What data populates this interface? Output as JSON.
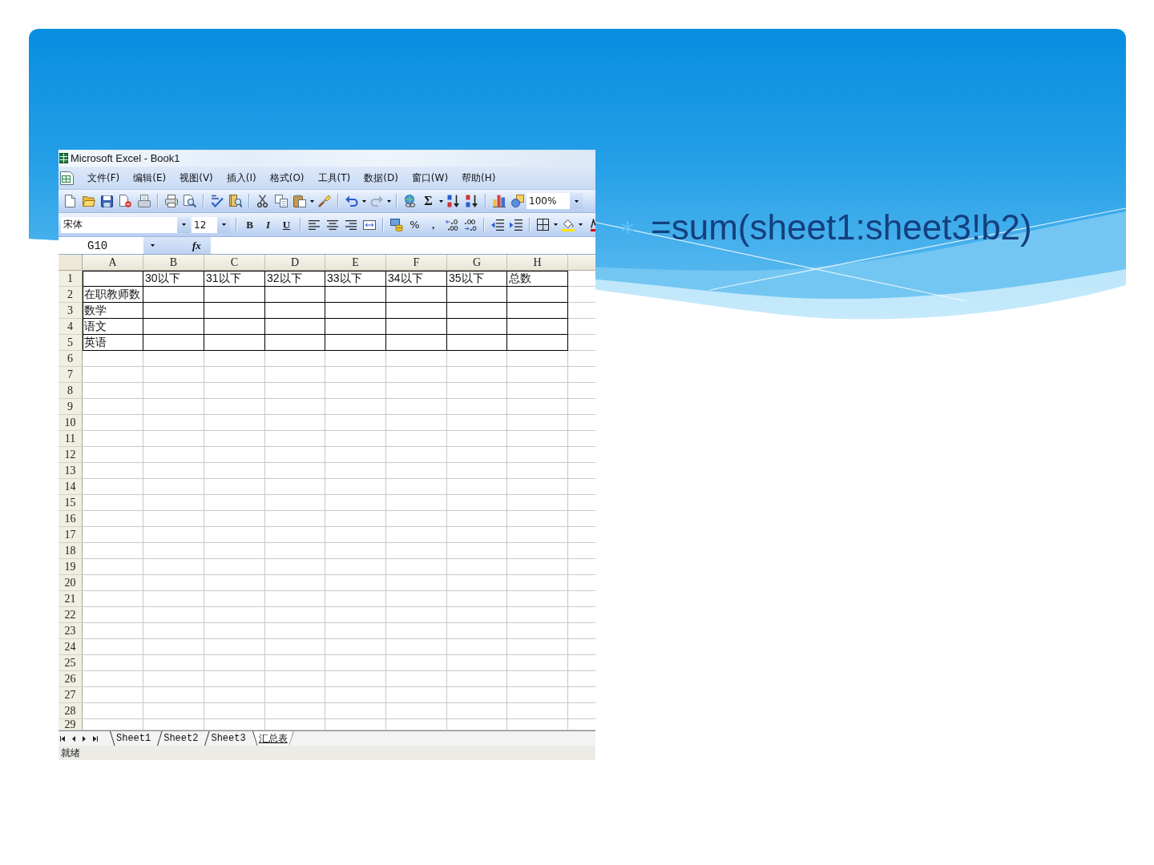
{
  "excel_window": {
    "title": "Microsoft Excel - Book1",
    "menu": [
      "文件(F)",
      "编辑(E)",
      "视图(V)",
      "插入(I)",
      "格式(O)",
      "工具(T)",
      "数据(D)",
      "窗口(W)",
      "帮助(H)"
    ],
    "standard_toolbar": {
      "redo": {
        "disabled": true
      },
      "autosum": "Σ",
      "zoom": "100%"
    },
    "formatting_toolbar": {
      "font": "宋体",
      "font_size": "12",
      "style_buttons": [
        "B",
        "I",
        "U"
      ],
      "percent": "%",
      "comma": ","
    },
    "formula_bar": {
      "name_box": "G10",
      "function_button": "fx"
    },
    "sheet": {
      "columns": [
        "A",
        "B",
        "C",
        "D",
        "E",
        "F",
        "G",
        "H"
      ],
      "rows": [
        {
          "number": "1",
          "bordered": true,
          "cells": [
            null,
            "30以下",
            "31以下",
            "32以下",
            "33以下",
            "34以下",
            "35以下",
            "总数"
          ]
        },
        {
          "number": "2",
          "bordered": true,
          "cells": [
            "在职教师数"
          ]
        },
        {
          "number": "3",
          "bordered": true,
          "cells": [
            "数学"
          ]
        },
        {
          "number": "4",
          "bordered": true,
          "cells": [
            "语文"
          ]
        },
        {
          "number": "5",
          "bordered": true,
          "cells": [
            "英语"
          ]
        },
        {
          "number": "6",
          "bordered": false
        },
        {
          "number": "7",
          "bordered": false
        },
        {
          "number": "8",
          "bordered": false
        },
        {
          "number": "9",
          "bordered": false
        },
        {
          "number": "10",
          "bordered": false
        },
        {
          "number": "11",
          "bordered": false
        },
        {
          "number": "12",
          "bordered": false
        },
        {
          "number": "13",
          "bordered": false
        },
        {
          "number": "14",
          "bordered": false
        },
        {
          "number": "15",
          "bordered": false
        },
        {
          "number": "16",
          "bordered": false
        },
        {
          "number": "17",
          "bordered": false
        },
        {
          "number": "18",
          "bordered": false
        },
        {
          "number": "19",
          "bordered": false
        },
        {
          "number": "20",
          "bordered": false
        },
        {
          "number": "21",
          "bordered": false
        },
        {
          "number": "22",
          "bordered": false
        },
        {
          "number": "23",
          "bordered": false
        },
        {
          "number": "24",
          "bordered": false
        },
        {
          "number": "25",
          "bordered": false
        },
        {
          "number": "26",
          "bordered": false
        },
        {
          "number": "27",
          "bordered": false
        },
        {
          "number": "28",
          "bordered": false
        },
        {
          "number": "29",
          "bordered": false
        }
      ]
    },
    "sheet_tabs": [
      {
        "label": "Sheet1",
        "selected": false
      },
      {
        "label": "Sheet2",
        "selected": false
      },
      {
        "label": "Sheet3",
        "selected": false
      },
      {
        "label": "汇总表",
        "selected": true
      }
    ],
    "status_bar": "就绪"
  },
  "bullets": [
    {
      "text": "=sum(sheet1:sheet3!b2)"
    }
  ]
}
